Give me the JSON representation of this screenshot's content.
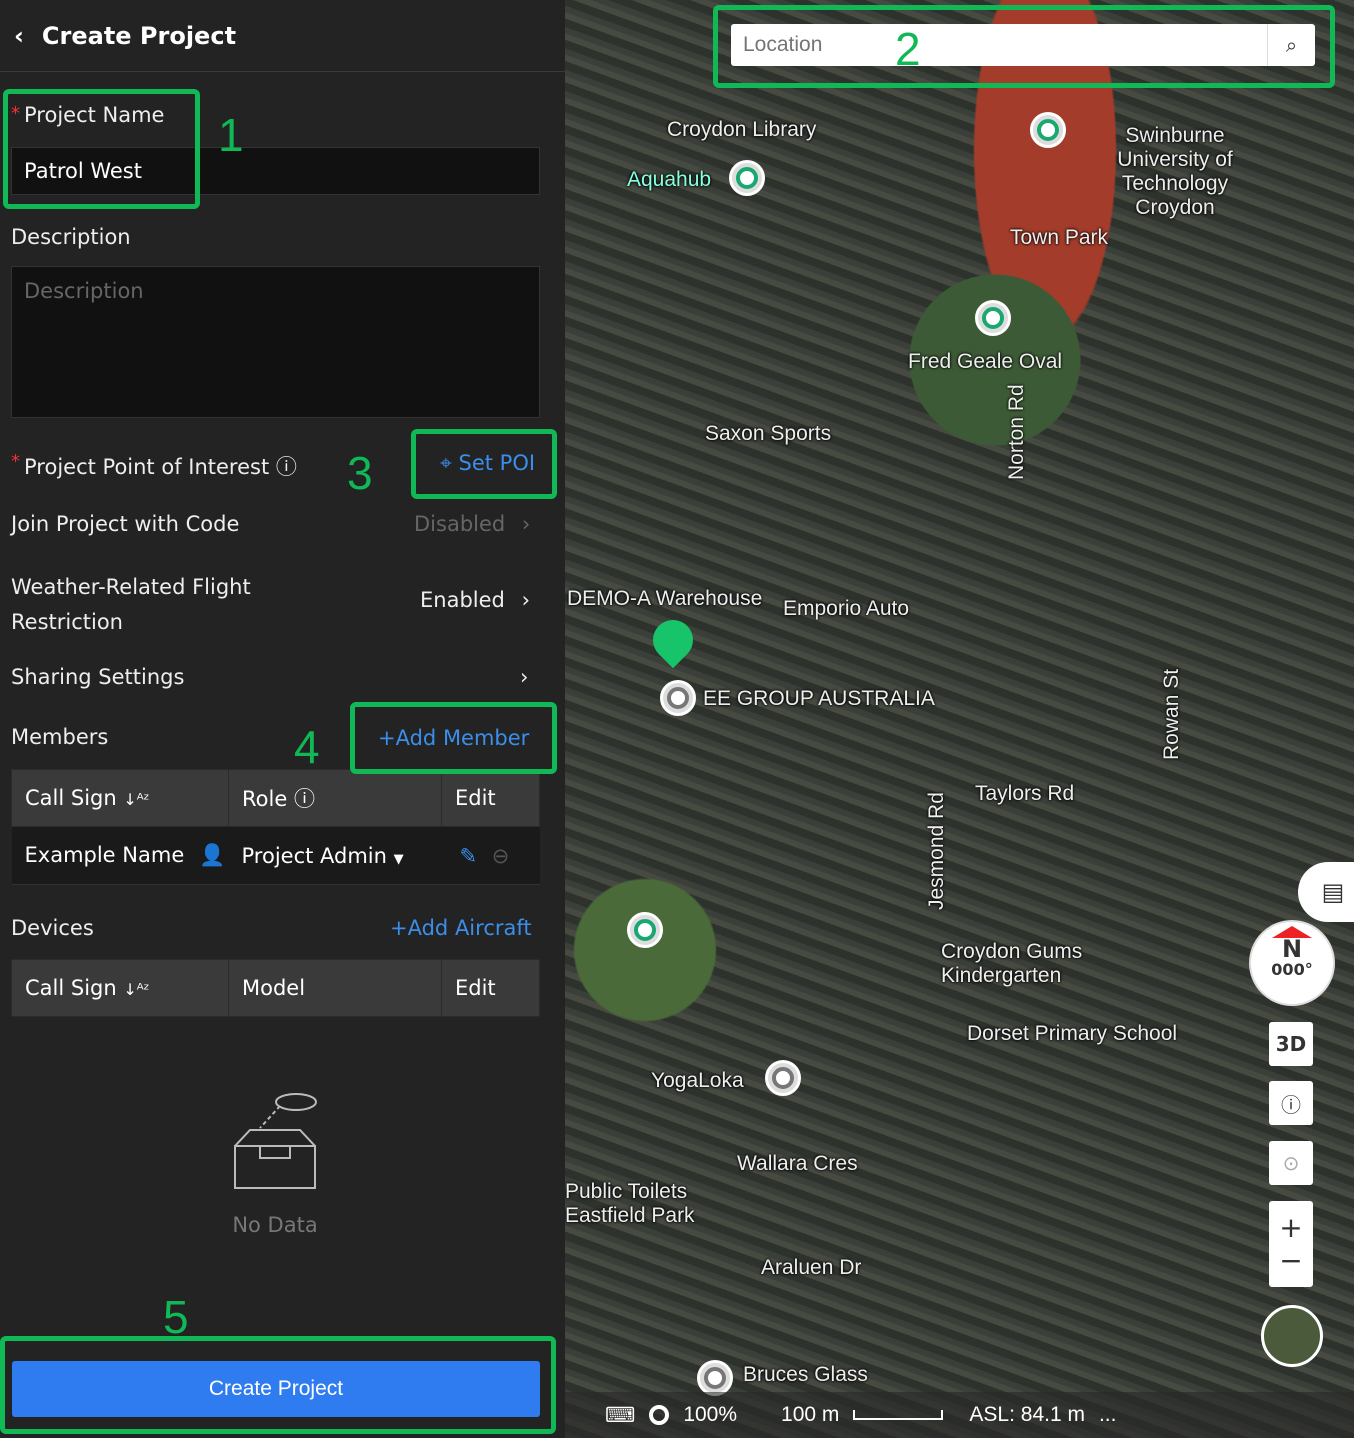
{
  "header": {
    "title": "Create Project"
  },
  "form": {
    "project_name_label": "Project Name",
    "project_name_value": "Patrol West",
    "description_label": "Description",
    "description_placeholder": "Description",
    "poi_label": "Project Point of Interest",
    "set_poi": "Set POI",
    "join_label": "Join Project with Code",
    "join_value": "Disabled",
    "weather_label_1": "Weather-Related Flight",
    "weather_label_2": "Restriction",
    "weather_value": "Enabled",
    "sharing_label": "Sharing Settings"
  },
  "members": {
    "title": "Members",
    "add": "Add Member",
    "headers": [
      "Call Sign",
      "Role",
      "Edit"
    ],
    "rows": [
      {
        "call_sign": "Example Name",
        "role": "Project Admin"
      }
    ]
  },
  "devices": {
    "title": "Devices",
    "add": "Add Aircraft",
    "headers": [
      "Call Sign",
      "Model",
      "Edit"
    ],
    "empty": "No Data"
  },
  "create_button": "Create Project",
  "annotations": [
    "1",
    "2",
    "3",
    "4",
    "5"
  ],
  "map": {
    "search_placeholder": "Location",
    "labels": [
      "Croydon Library",
      "Aquahub",
      "Swinburne University of Technology Croydon",
      "Town Park",
      "Fred Geale Oval",
      "Saxon Sports",
      "DEMO-A Warehouse",
      "Emporio Auto",
      "EE GROUP AUSTRALIA",
      "Taylors Rd",
      "Croydon Gums Kindergarten",
      "Dorset Primary School",
      "YogaLoka",
      "Wallara Cres",
      "Araluen Dr",
      "Bruces Glass",
      "Norton Rd",
      "Rowan St",
      "Jesmond Rd",
      "Public Toilets",
      "Eastfield Park"
    ],
    "compass": {
      "letter": "N",
      "heading": "000°"
    },
    "btn_3d": "3D",
    "status": {
      "zoom": "100%",
      "scale": "100 m",
      "asl": "ASL: 84.1 m",
      "more": "..."
    }
  }
}
